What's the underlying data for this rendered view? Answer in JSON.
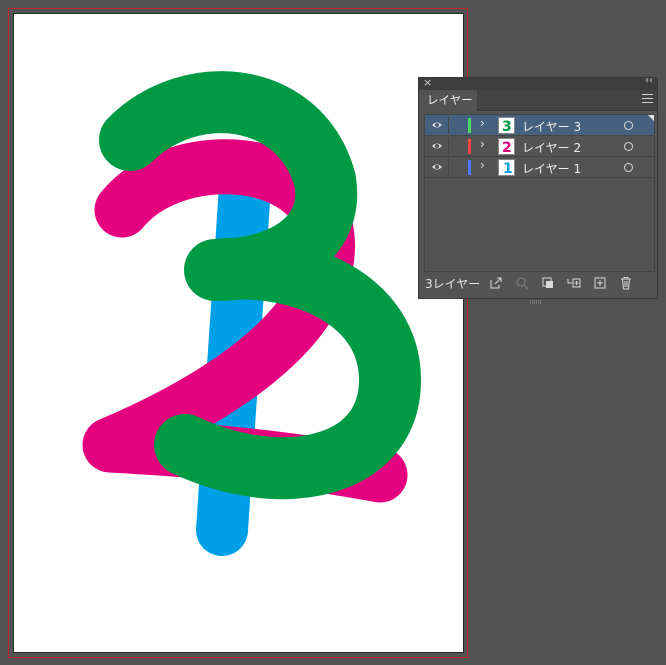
{
  "window": {
    "close_glyph": "×",
    "collapse_glyph": "‹‹"
  },
  "artwork": {
    "strokes": [
      {
        "name": "layer-1-stroke",
        "color": "#00a0e9"
      },
      {
        "name": "layer-2-stroke",
        "color": "#e4007f"
      },
      {
        "name": "layer-3-stroke",
        "color": "#009944"
      }
    ]
  },
  "panel": {
    "tab_label": "レイヤー",
    "menu_icon": "hamburger-menu-icon",
    "layers": [
      {
        "name": "レイヤー 3",
        "thumb_glyph": "3",
        "thumb_color": "#009944",
        "bar_color": "#4cd964",
        "selected": true
      },
      {
        "name": "レイヤー 2",
        "thumb_glyph": "2",
        "thumb_color": "#e4007f",
        "bar_color": "#ff4444",
        "selected": false
      },
      {
        "name": "レイヤー 1",
        "thumb_glyph": "1",
        "thumb_color": "#00a0e9",
        "bar_color": "#4f7cff",
        "selected": false
      }
    ],
    "footer": {
      "count_label": "3レイヤー",
      "icons": [
        "export-icon",
        "search-icon",
        "clipping-mask-icon",
        "new-sublayer-icon",
        "new-layer-icon",
        "trash-icon"
      ]
    }
  }
}
